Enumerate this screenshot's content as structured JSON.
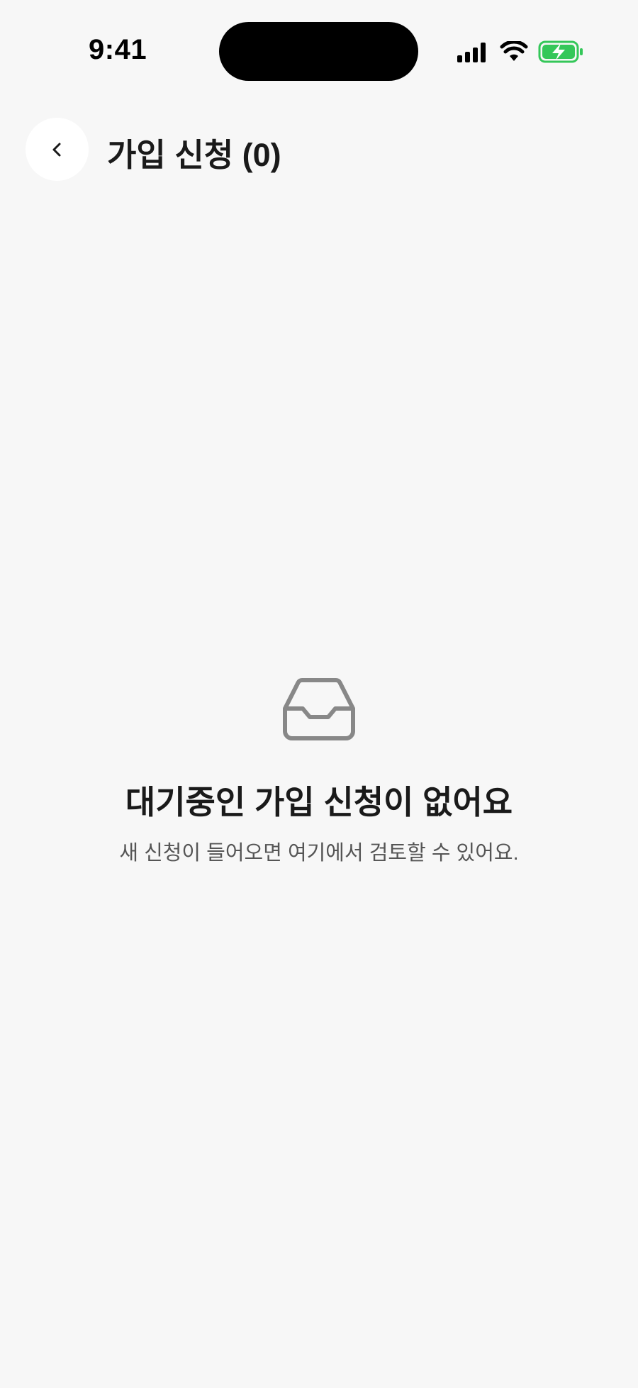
{
  "status_bar": {
    "time": "9:41"
  },
  "header": {
    "back_icon": "chevron-left-icon",
    "title": "가입 신청 (0)"
  },
  "empty_state": {
    "icon": "inbox-icon",
    "title": "대기중인 가입 신청이 없어요",
    "subtitle": "새 신청이 들어오면 여기에서 검토할 수 있어요."
  },
  "colors": {
    "background": "#f7f7f7",
    "battery_charge": "#34c759",
    "icon_gray": "#888888"
  }
}
